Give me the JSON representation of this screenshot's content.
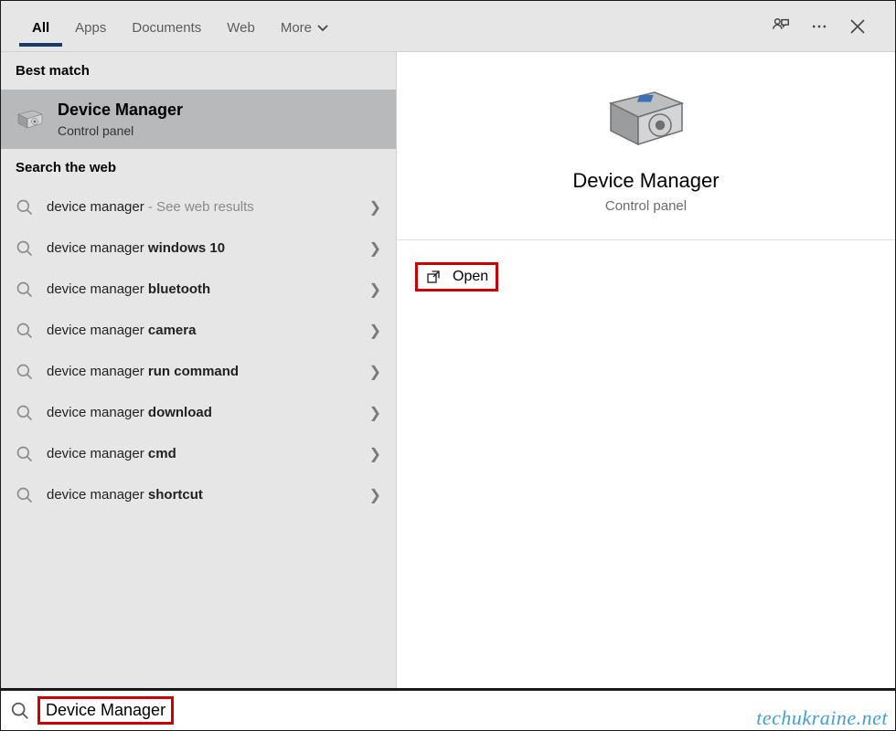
{
  "tabs": {
    "items": [
      "All",
      "Apps",
      "Documents",
      "Web",
      "More"
    ],
    "active_index": 0
  },
  "sections": {
    "best_match": "Best match",
    "search_web": "Search the web"
  },
  "best_match": {
    "title": "Device Manager",
    "subtitle": "Control panel"
  },
  "suggestions": [
    {
      "prefix": "device manager",
      "bold": "",
      "suffix": " - See web results"
    },
    {
      "prefix": "device manager",
      "bold": " windows 10",
      "suffix": ""
    },
    {
      "prefix": "device manager",
      "bold": " bluetooth",
      "suffix": ""
    },
    {
      "prefix": "device manager",
      "bold": " camera",
      "suffix": ""
    },
    {
      "prefix": "device manager",
      "bold": " run command",
      "suffix": ""
    },
    {
      "prefix": "device manager",
      "bold": " download",
      "suffix": ""
    },
    {
      "prefix": "device manager",
      "bold": " cmd",
      "suffix": ""
    },
    {
      "prefix": "device manager",
      "bold": " shortcut",
      "suffix": ""
    }
  ],
  "detail": {
    "title": "Device Manager",
    "subtitle": "Control panel",
    "open_label": "Open"
  },
  "search": {
    "query": "Device Manager"
  },
  "watermark": "techukraine.net"
}
